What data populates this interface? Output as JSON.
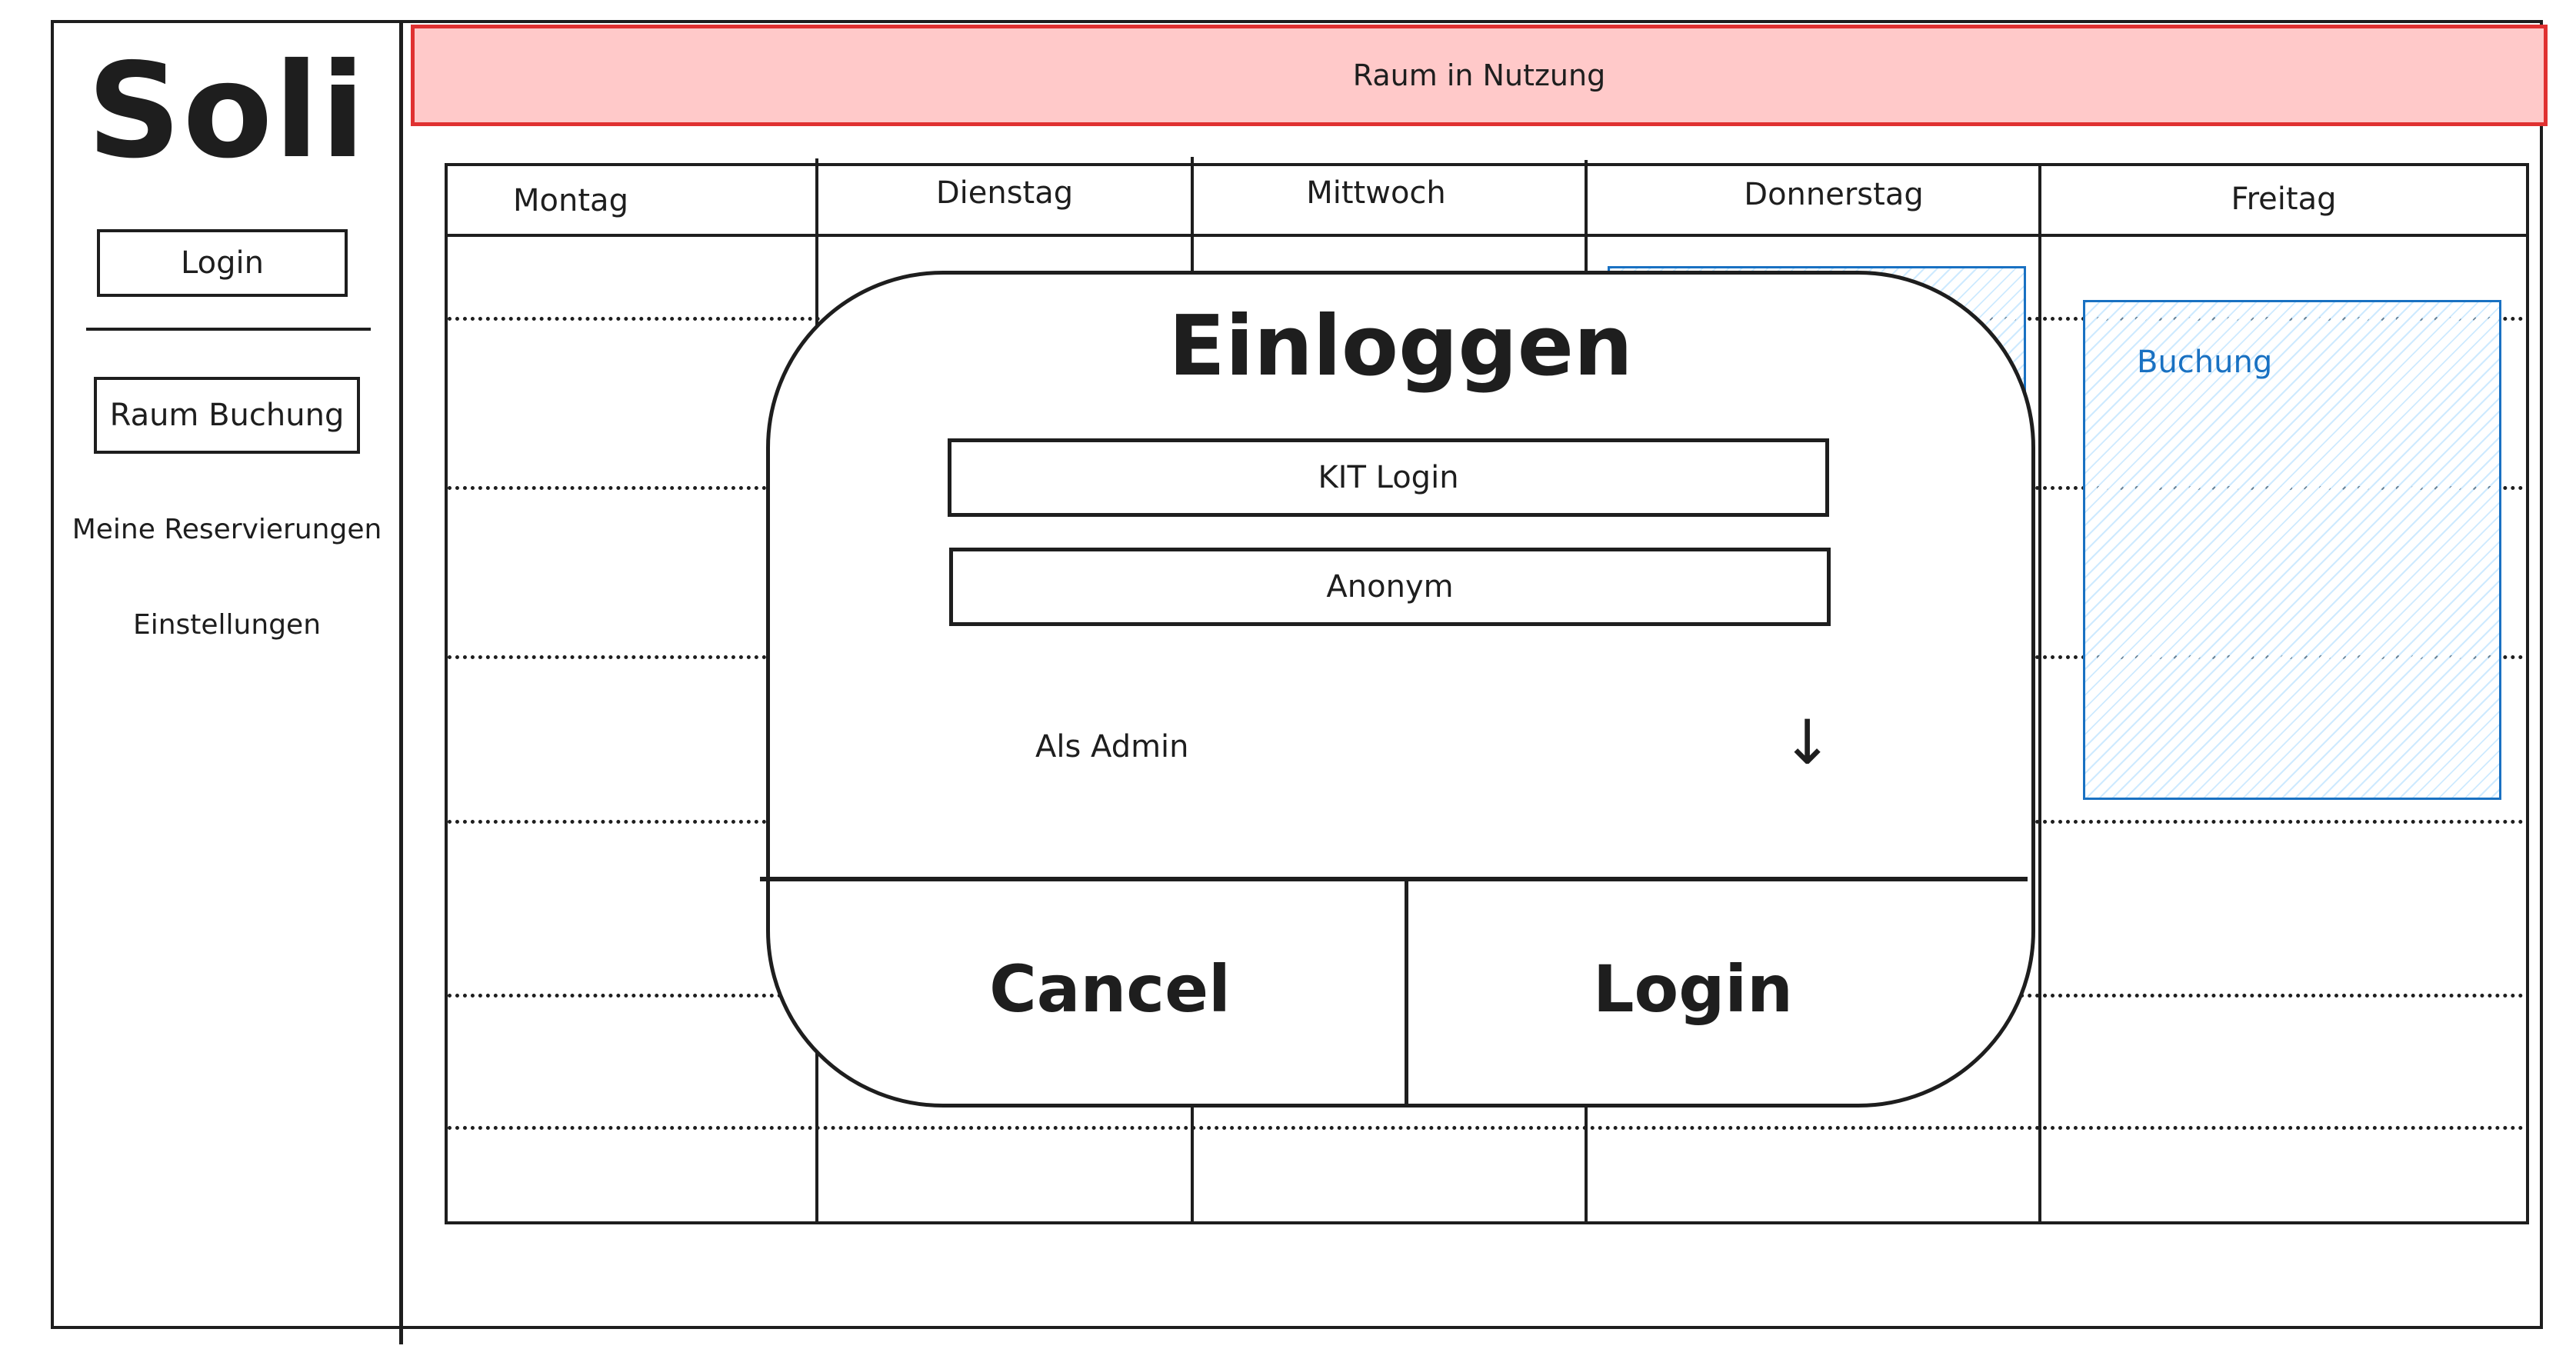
{
  "app": {
    "logo": "Soli"
  },
  "sidebar": {
    "login_button": "Login",
    "booking_button": "Raum Buchung",
    "reservations_link": "Meine Reservierungen",
    "settings_link": "Einstellungen"
  },
  "banner": {
    "text": "Raum in Nutzung",
    "background_color": "#ffc9c9",
    "border_color": "#e03131"
  },
  "calendar": {
    "days": [
      "Montag",
      "Dienstag",
      "Mittwoch",
      "Donnerstag",
      "Freitag"
    ],
    "booking_label": "Buchung",
    "booking_color": "#1971c2"
  },
  "modal": {
    "title": "Einloggen",
    "kit_login_option": "KIT Login",
    "anonymous_option": "Anonym",
    "admin_label": "Als Admin",
    "admin_toggle_icon": "↓",
    "cancel_button": "Cancel",
    "login_button": "Login"
  }
}
